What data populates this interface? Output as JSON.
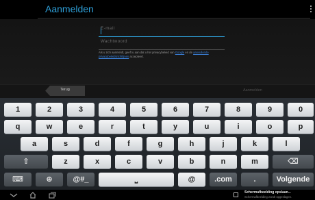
{
  "app": {
    "title": "Aanmelden"
  },
  "form": {
    "email_placeholder": "E-mail",
    "password_placeholder": "Wachtwoord",
    "privacy_prefix": "Als u zich aanmeldt, geeft u aan dat u het privacybeleid van ",
    "privacy_link_google": "Google",
    "privacy_mid": " en de ",
    "privacy_link_additional": "aanvullende privacybeleidsrichtlijnen",
    "privacy_suffix": " accepteert."
  },
  "buttons": {
    "back": "Terug",
    "next": "Aanmelden"
  },
  "keyboard": {
    "row1": [
      "1",
      "2",
      "3",
      "4",
      "5",
      "6",
      "7",
      "8",
      "9",
      "0"
    ],
    "row2": [
      "q",
      "w",
      "e",
      "r",
      "t",
      "y",
      "u",
      "i",
      "o",
      "p"
    ],
    "row3": [
      "a",
      "s",
      "d",
      "f",
      "g",
      "h",
      "j",
      "k",
      "l"
    ],
    "row4": [
      "z",
      "x",
      "c",
      "v",
      "b",
      "n",
      "m"
    ],
    "symbols_key": "@#_",
    "at_key": "@",
    "com_key": ".com",
    "period_key": ".",
    "action_key": "Volgende",
    "shift_glyph": "⇧",
    "backspace_glyph": "⌫",
    "globe_glyph": "⊕",
    "keyboard_glyph": "⌨",
    "space_glyph": "⎵"
  },
  "notification": {
    "title": "Schermafbeelding opslaan...",
    "subtitle": "Schermafbeelding wordt opgeslagen."
  },
  "colors": {
    "accent": "#2e9fd8",
    "link": "#3a7fd6"
  }
}
